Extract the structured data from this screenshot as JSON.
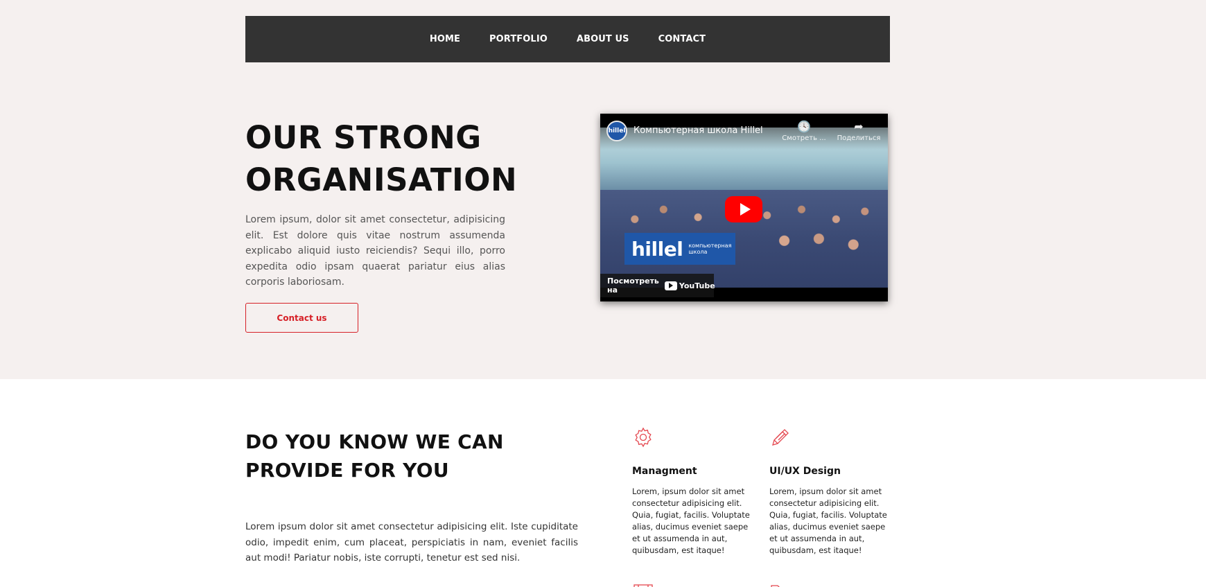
{
  "nav": {
    "items": [
      "HOME",
      "PORTFOLIO",
      "ABOUT US",
      "CONTACT"
    ]
  },
  "hero": {
    "title_line1": "OUR STRONG",
    "title_line2": "ORGANISATION",
    "text": "Lorem ipsum, dolor sit amet consectetur, adipisicing elit. Est dolore quis vitae nostrum assumenda explicabo aliquid iusto reiciendis? Sequi illo, porro expedita odio ipsam quaerat pariatur eius alias corporis laboriosam.",
    "button_label": "Contact us"
  },
  "video": {
    "title": "Компьютерная школа Hillel",
    "channel_avatar_text": "hillel",
    "watch_later_label": "Смотреть ...",
    "share_label": "Поделиться",
    "banner_logo": "hillel",
    "banner_sub": "компьютерная школа",
    "watch_on_label": "Посмотреть на",
    "youtube_label": "YouTube"
  },
  "section2": {
    "title_line1": "DO YOU KNOW WE CAN",
    "title_line2": "PROVIDE FOR YOU",
    "text": "Lorem ipsum dolor sit amet consectetur adipisicing elit. Iste cupiditate odio, impedit enim, cum placeat, perspiciatis in nam, eveniet facilis aut modi! Pariatur nobis, iste corrupti, tenetur est sed nisi."
  },
  "services": [
    {
      "icon": "gear-icon",
      "title": "Managment",
      "text": "Lorem, ipsum dolor sit amet consectetur adipisicing elit. Quia, fugiat, facilis. Voluptate alias, ducimus eveniet saepe et ut assumenda in aut, quibusdam, est itaque!"
    },
    {
      "icon": "pencil-icon",
      "title": "UI/UX Design",
      "text": "Lorem, ipsum dolor sit amet consectetur adipisicing elit. Quia, fugiat, facilis. Voluptate alias, ducimus eveniet saepe et ut assumenda in aut, quibusdam, est itaque!"
    }
  ],
  "colors": {
    "accent": "#d61f26",
    "nav_bg": "#333333",
    "hero_bg": "#f5f0ef",
    "youtube_red": "#ff0000",
    "icon_color": "#e4474f"
  }
}
